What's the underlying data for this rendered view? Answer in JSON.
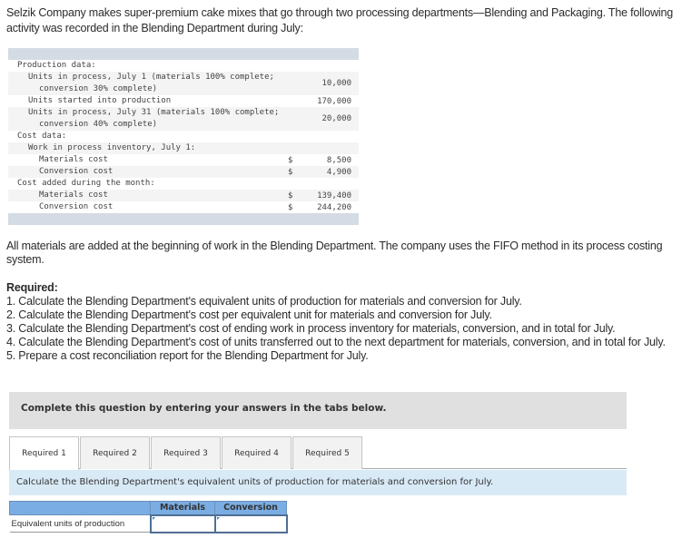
{
  "intro": "Selzik Company makes super-premium cake mixes that go through two processing departments—Blending and Packaging. The following activity was recorded in the Blending Department during July:",
  "data_table": {
    "rows": [
      {
        "label": "Production data:",
        "indent": 0,
        "dollar": "",
        "value": ""
      },
      {
        "label": "Units in process, July 1 (materials 100% complete;",
        "label2": "conversion 30% complete)",
        "indent": 1,
        "dollar": "",
        "value": "10,000"
      },
      {
        "label": "Units started into production",
        "indent": 1,
        "dollar": "",
        "value": "170,000"
      },
      {
        "label": "Units in process, July 31 (materials 100% complete;",
        "label2": "conversion 40% complete)",
        "indent": 1,
        "dollar": "",
        "value": "20,000"
      },
      {
        "label": "Cost data:",
        "indent": 0,
        "dollar": "",
        "value": ""
      },
      {
        "label": "Work in process inventory, July 1:",
        "indent": 1,
        "dollar": "",
        "value": ""
      },
      {
        "label": "Materials cost",
        "indent": 2,
        "dollar": "$",
        "value": "8,500"
      },
      {
        "label": "Conversion cost",
        "indent": 2,
        "dollar": "$",
        "value": "4,900"
      },
      {
        "label": "Cost added during the month:",
        "indent": 0,
        "dollar": "",
        "value": ""
      },
      {
        "label": "Materials cost",
        "indent": 2,
        "dollar": "$",
        "value": "139,400"
      },
      {
        "label": "Conversion cost",
        "indent": 2,
        "dollar": "$",
        "value": "244,200"
      }
    ]
  },
  "paragraph1": "All materials are added at the beginning of work in the Blending Department. The company uses the FIFO method in its process costing system.",
  "required": {
    "title": "Required:",
    "items": [
      "1. Calculate the Blending Department's equivalent units of production for materials and conversion for July.",
      "2. Calculate the Blending Department's cost per equivalent unit for materials and conversion for July.",
      "3. Calculate the Blending Department's cost of ending work in process inventory for materials, conversion, and in total for July.",
      "4. Calculate the Blending Department's cost of units transferred out to the next department for materials, conversion, and in total for July.",
      "5. Prepare a cost reconciliation report for the Blending Department for July."
    ]
  },
  "instruction": "Complete this question by entering your answers in the tabs below.",
  "tabs": [
    {
      "label": "Required 1",
      "active": true
    },
    {
      "label": "Required 2",
      "active": false
    },
    {
      "label": "Required 3",
      "active": false
    },
    {
      "label": "Required 4",
      "active": false
    },
    {
      "label": "Required 5",
      "active": false
    }
  ],
  "task": "Calculate the Blending Department's equivalent units of production for materials and conversion for July.",
  "answer_table": {
    "headers": [
      "",
      "Materials",
      "Conversion"
    ],
    "row_label": "Equivalent units of production",
    "materials_value": "",
    "conversion_value": ""
  }
}
